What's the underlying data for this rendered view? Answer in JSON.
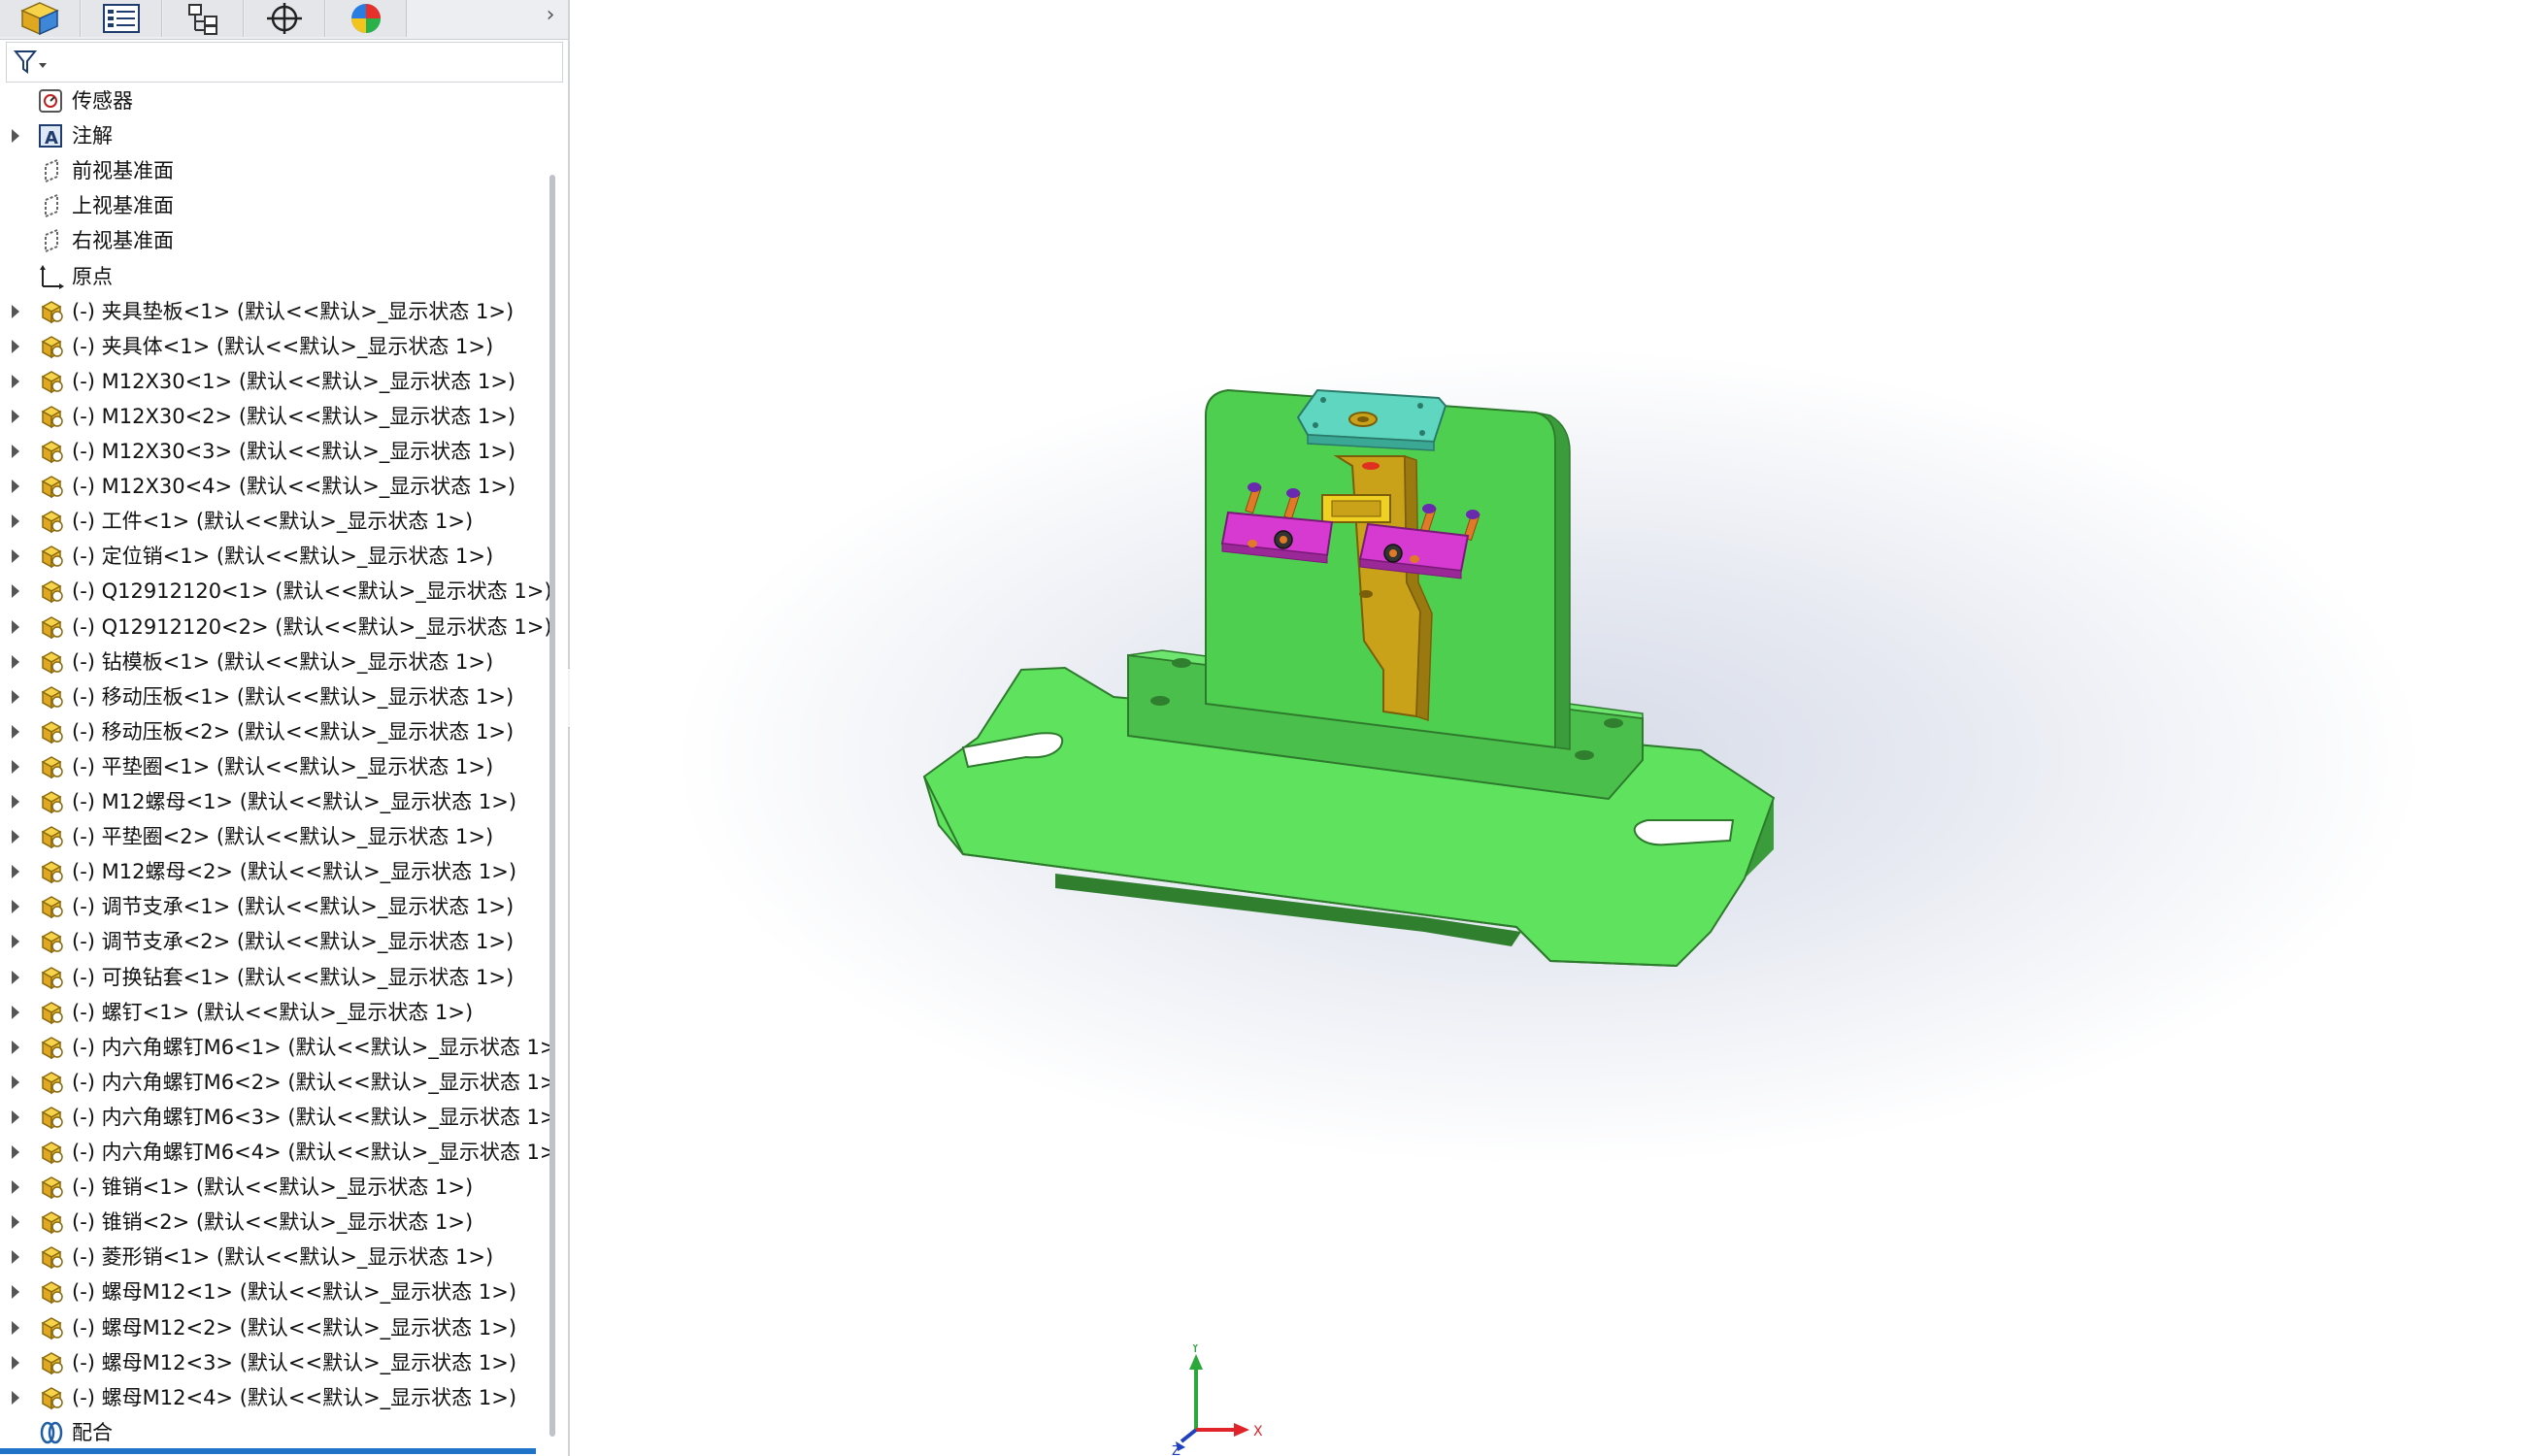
{
  "tabs": [
    {
      "name": "feature-manager-tab",
      "icon": "assembly-cube-icon"
    },
    {
      "name": "property-manager-tab",
      "icon": "property-list-icon"
    },
    {
      "name": "configuration-manager-tab",
      "icon": "configuration-icon"
    },
    {
      "name": "dimxpert-tab",
      "icon": "crosshair-icon"
    },
    {
      "name": "display-manager-tab",
      "icon": "color-wheel-icon"
    }
  ],
  "tab_overflow": "›",
  "filter": {
    "icon": "filter-icon",
    "dropdown": "▾"
  },
  "tree": {
    "items": [
      {
        "label": "传感器",
        "icon": "sensor-icon",
        "expandable": false
      },
      {
        "label": "注解",
        "icon": "annotation-icon",
        "expandable": true
      },
      {
        "label": "前视基准面",
        "icon": "plane-icon",
        "expandable": false
      },
      {
        "label": "上视基准面",
        "icon": "plane-icon",
        "expandable": false
      },
      {
        "label": "右视基准面",
        "icon": "plane-icon",
        "expandable": false
      },
      {
        "label": "原点",
        "icon": "origin-icon",
        "expandable": false
      },
      {
        "label": "(-) 夹具垫板<1> (默认<<默认>_显示状态 1>)",
        "icon": "part-icon",
        "expandable": true
      },
      {
        "label": "(-) 夹具体<1> (默认<<默认>_显示状态 1>)",
        "icon": "part-icon",
        "expandable": true
      },
      {
        "label": "(-) M12X30<1> (默认<<默认>_显示状态 1>)",
        "icon": "part-icon",
        "expandable": true
      },
      {
        "label": "(-) M12X30<2> (默认<<默认>_显示状态 1>)",
        "icon": "part-icon",
        "expandable": true
      },
      {
        "label": "(-) M12X30<3> (默认<<默认>_显示状态 1>)",
        "icon": "part-icon",
        "expandable": true
      },
      {
        "label": "(-) M12X30<4> (默认<<默认>_显示状态 1>)",
        "icon": "part-icon",
        "expandable": true
      },
      {
        "label": "(-) 工件<1> (默认<<默认>_显示状态 1>)",
        "icon": "part-icon",
        "expandable": true
      },
      {
        "label": "(-) 定位销<1> (默认<<默认>_显示状态 1>)",
        "icon": "part-icon",
        "expandable": true
      },
      {
        "label": "(-) Q12912120<1> (默认<<默认>_显示状态 1>)",
        "icon": "part-icon",
        "expandable": true
      },
      {
        "label": "(-) Q12912120<2> (默认<<默认>_显示状态 1>)",
        "icon": "part-icon",
        "expandable": true
      },
      {
        "label": "(-) 钻模板<1> (默认<<默认>_显示状态 1>)",
        "icon": "part-icon",
        "expandable": true
      },
      {
        "label": "(-) 移动压板<1> (默认<<默认>_显示状态 1>)",
        "icon": "part-icon",
        "expandable": true
      },
      {
        "label": "(-) 移动压板<2> (默认<<默认>_显示状态 1>)",
        "icon": "part-icon",
        "expandable": true
      },
      {
        "label": "(-) 平垫圈<1> (默认<<默认>_显示状态 1>)",
        "icon": "part-icon",
        "expandable": true
      },
      {
        "label": "(-) M12螺母<1> (默认<<默认>_显示状态 1>)",
        "icon": "part-icon",
        "expandable": true
      },
      {
        "label": "(-) 平垫圈<2> (默认<<默认>_显示状态 1>)",
        "icon": "part-icon",
        "expandable": true
      },
      {
        "label": "(-) M12螺母<2> (默认<<默认>_显示状态 1>)",
        "icon": "part-icon",
        "expandable": true
      },
      {
        "label": "(-) 调节支承<1> (默认<<默认>_显示状态 1>)",
        "icon": "part-icon",
        "expandable": true
      },
      {
        "label": "(-) 调节支承<2> (默认<<默认>_显示状态 1>)",
        "icon": "part-icon",
        "expandable": true
      },
      {
        "label": "(-) 可换钻套<1> (默认<<默认>_显示状态 1>)",
        "icon": "part-icon",
        "expandable": true
      },
      {
        "label": "(-) 螺钉<1> (默认<<默认>_显示状态 1>)",
        "icon": "part-icon",
        "expandable": true
      },
      {
        "label": "(-) 内六角螺钉M6<1> (默认<<默认>_显示状态 1>",
        "icon": "part-icon",
        "expandable": true
      },
      {
        "label": "(-) 内六角螺钉M6<2> (默认<<默认>_显示状态 1>",
        "icon": "part-icon",
        "expandable": true
      },
      {
        "label": "(-) 内六角螺钉M6<3> (默认<<默认>_显示状态 1>",
        "icon": "part-icon",
        "expandable": true
      },
      {
        "label": "(-) 内六角螺钉M6<4> (默认<<默认>_显示状态 1>",
        "icon": "part-icon",
        "expandable": true
      },
      {
        "label": "(-) 锥销<1> (默认<<默认>_显示状态 1>)",
        "icon": "part-icon",
        "expandable": true
      },
      {
        "label": "(-) 锥销<2> (默认<<默认>_显示状态 1>)",
        "icon": "part-icon",
        "expandable": true
      },
      {
        "label": "(-) 菱形销<1> (默认<<默认>_显示状态 1>)",
        "icon": "part-icon",
        "expandable": true
      },
      {
        "label": "(-) 螺母M12<1> (默认<<默认>_显示状态 1>)",
        "icon": "part-icon",
        "expandable": true
      },
      {
        "label": "(-) 螺母M12<2> (默认<<默认>_显示状态 1>)",
        "icon": "part-icon",
        "expandable": true
      },
      {
        "label": "(-) 螺母M12<3> (默认<<默认>_显示状态 1>)",
        "icon": "part-icon",
        "expandable": true
      },
      {
        "label": "(-) 螺母M12<4> (默认<<默认>_显示状态 1>)",
        "icon": "part-icon",
        "expandable": true
      },
      {
        "label": "配合",
        "icon": "mates-icon",
        "expandable": false
      }
    ]
  },
  "splitter_glyph": "◦",
  "triad": {
    "x_label": "X",
    "y_label": "Y",
    "z_label": "Z"
  },
  "colors": {
    "base_plate": "#5fe35f",
    "fixture_body": "#4fcf4f",
    "drill_plate": "#5fd6c0",
    "clamp_plates": "#d63ad0",
    "workpiece": "#c9a21a",
    "triad_x": "#e0242a",
    "triad_y": "#2aa83a",
    "triad_z": "#2040c0"
  }
}
